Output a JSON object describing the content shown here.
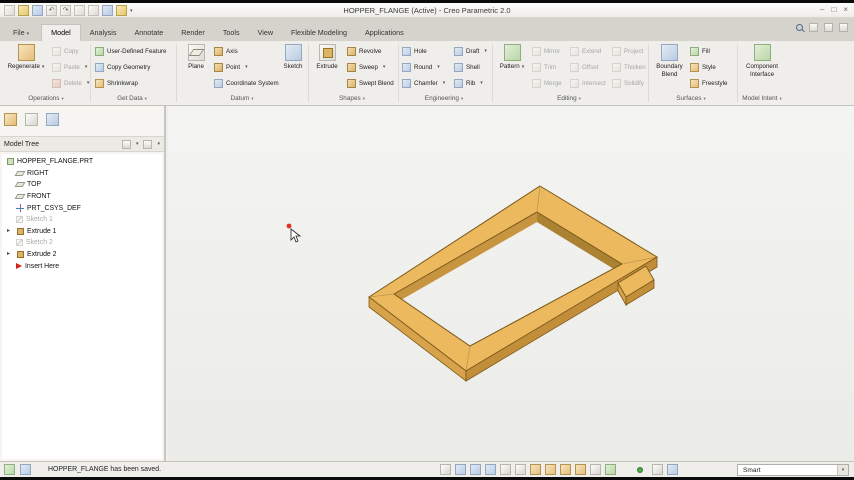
{
  "titlebar": {
    "title": "HOPPER_FLANGE (Active) - Creo Parametric 2.0",
    "minimize": "–",
    "restore": "□",
    "close": "×"
  },
  "qat_glyphs": {
    "undo": "↶",
    "redo": "↷"
  },
  "menu": {
    "file": "File"
  },
  "tabs": [
    "Model",
    "Analysis",
    "Annotate",
    "Render",
    "Tools",
    "View",
    "Flexible Modeling",
    "Applications"
  ],
  "active_tab": "Model",
  "ribbon": {
    "group_labels": [
      "Operations",
      "Get Data",
      "Datum",
      "Shapes",
      "Engineering",
      "Editing",
      "Surfaces",
      "Model Intent"
    ],
    "regenerate": "Regenerate",
    "operations": [
      "Copy",
      "Paste",
      "Delete"
    ],
    "get_data": [
      "User-Defined Feature",
      "Copy Geometry",
      "Shrinkwrap"
    ],
    "plane": "Plane",
    "datum": [
      "Axis",
      "Point",
      "Coordinate System"
    ],
    "sketch": "Sketch",
    "extrude": "Extrude",
    "shapes": [
      "Revolve",
      "Sweep",
      "Swept Blend"
    ],
    "engineering_col1": [
      "Hole",
      "Round",
      "Chamfer"
    ],
    "engineering_col2": [
      "Draft",
      "Shell",
      "Rib"
    ],
    "pattern": "Pattern",
    "editing_col1": [
      "Mirror",
      "Trim",
      "Merge"
    ],
    "editing_col2": [
      "Extend",
      "Offset",
      "Intersect"
    ],
    "editing_col3": [
      "Project",
      "Thicken",
      "Solidify"
    ],
    "boundary_blend": "Boundary Blend",
    "surfaces": [
      "Fill",
      "Style",
      "Freestyle"
    ],
    "component_interface": "Component Interface"
  },
  "model_tree": {
    "title": "Model Tree",
    "items": [
      "HOPPER_FLANGE.PRT",
      "RIGHT",
      "TOP",
      "FRONT",
      "PRT_CSYS_DEF",
      "Sketch 1",
      "Extrude 1",
      "Sketch 2",
      "Extrude 2",
      "Insert Here"
    ]
  },
  "statusbar": {
    "message": "HOPPER_FLANGE has been saved.",
    "filter": "Smart"
  },
  "colors": {
    "model_top": "#ecb95f",
    "model_side_left": "#d7a249",
    "model_side_right": "#c28e39",
    "model_inner_wall_left": "#c79540",
    "model_inner_wall_right": "#ab8132",
    "model_edge": "#7a5a1a",
    "status_ok": "#44aa44",
    "cursor_red": "#e03020"
  }
}
